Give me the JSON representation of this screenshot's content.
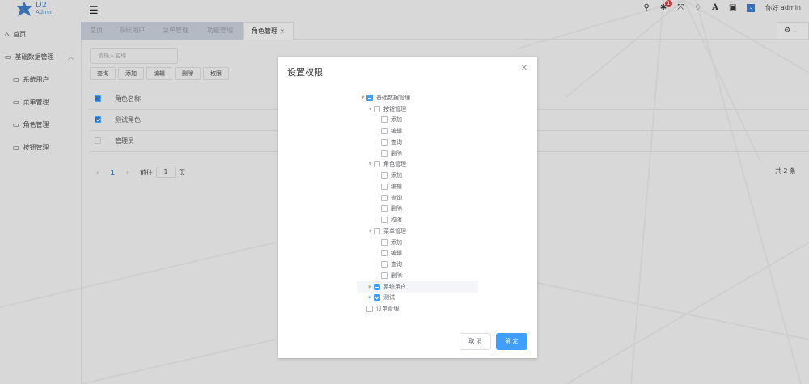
{
  "header": {
    "logo_line1": "D2",
    "logo_line2": "Admin",
    "notification_count": "1",
    "greeting": "你好 admin"
  },
  "sidebar": {
    "items": [
      {
        "label": "首页",
        "icon": "home-icon"
      },
      {
        "label": "基础数据管理",
        "icon": "folder-icon"
      },
      {
        "label": "系统用户",
        "icon": "folder-icon"
      },
      {
        "label": "菜单管理",
        "icon": "folder-icon"
      },
      {
        "label": "角色管理",
        "icon": "folder-icon"
      },
      {
        "label": "按钮管理",
        "icon": "folder-icon"
      }
    ]
  },
  "tabs": [
    "首页",
    "系统用户",
    "菜单管理",
    "功能管理",
    "角色管理"
  ],
  "toolbar": {
    "search_placeholder": "请输入名称",
    "buttons": [
      "查询",
      "添加",
      "编辑",
      "删除",
      "权限"
    ]
  },
  "table": {
    "header": "角色名称",
    "rows": [
      {
        "name": "测试角色",
        "checked": true
      },
      {
        "name": "管理员",
        "checked": false
      }
    ]
  },
  "pagination": {
    "current": "1",
    "goto_label": "前往",
    "goto_value": "1",
    "page_suffix": "页",
    "total": "共 2 条"
  },
  "modal": {
    "title": "设置权限",
    "cancel": "取 消",
    "confirm": "确 定",
    "tree": [
      {
        "label": "基础数据管理",
        "level": 0,
        "state": "indeterminate",
        "arrow": "down"
      },
      {
        "label": "按钮管理",
        "level": 1,
        "state": "unchecked",
        "arrow": "down"
      },
      {
        "label": "添加",
        "level": 2,
        "state": "unchecked"
      },
      {
        "label": "编辑",
        "level": 2,
        "state": "unchecked"
      },
      {
        "label": "查询",
        "level": 2,
        "state": "unchecked"
      },
      {
        "label": "删除",
        "level": 2,
        "state": "unchecked"
      },
      {
        "label": "角色管理",
        "level": 1,
        "state": "unchecked",
        "arrow": "down"
      },
      {
        "label": "添加",
        "level": 2,
        "state": "unchecked"
      },
      {
        "label": "编辑",
        "level": 2,
        "state": "unchecked"
      },
      {
        "label": "查询",
        "level": 2,
        "state": "unchecked"
      },
      {
        "label": "删除",
        "level": 2,
        "state": "unchecked"
      },
      {
        "label": "权限",
        "level": 2,
        "state": "unchecked"
      },
      {
        "label": "菜单管理",
        "level": 1,
        "state": "unchecked",
        "arrow": "down"
      },
      {
        "label": "添加",
        "level": 2,
        "state": "unchecked"
      },
      {
        "label": "编辑",
        "level": 2,
        "state": "unchecked"
      },
      {
        "label": "查询",
        "level": 2,
        "state": "unchecked"
      },
      {
        "label": "删除",
        "level": 2,
        "state": "unchecked"
      },
      {
        "label": "系统用户",
        "level": 1,
        "state": "indeterminate",
        "arrow": "right",
        "highlight": true
      },
      {
        "label": "测试",
        "level": 1,
        "state": "checked",
        "arrow": "right"
      },
      {
        "label": "订单管理",
        "level": 0,
        "state": "unchecked"
      }
    ]
  },
  "colors": {
    "primary": "#409eff",
    "badge": "#c23a3a"
  }
}
